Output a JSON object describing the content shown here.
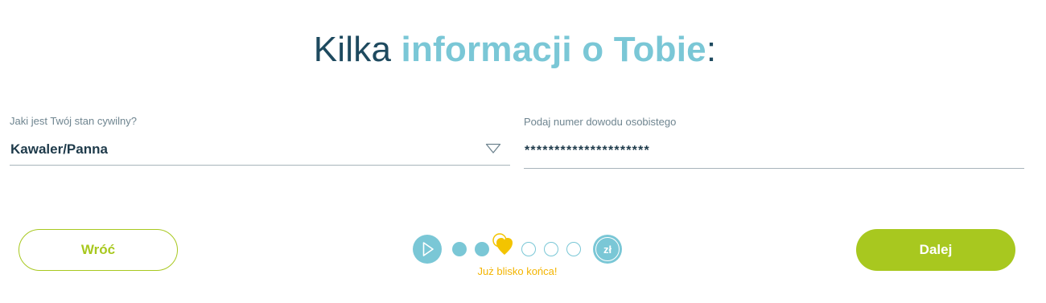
{
  "heading": {
    "prefix": "Kilka ",
    "accent": "informacji o Tobie",
    "suffix": ":"
  },
  "marital_status": {
    "label": "Jaki jest Twój stan cywilny?",
    "value": "Kawaler/Panna",
    "icon": "chevron-down-icon"
  },
  "id_number": {
    "label": "Podaj numer dowodu osobistego",
    "value": "*********************"
  },
  "buttons": {
    "back": "Wróć",
    "next": "Dalej"
  },
  "progress": {
    "caption": "Już blisko końca!",
    "current_step": 3,
    "total_steps": 6,
    "end_label": "zł",
    "start_icon": "play-icon",
    "current_icon": "heart-icon"
  },
  "colors": {
    "primary_dark": "#1e4a5f",
    "accent_teal": "#7ac7d6",
    "accent_green": "#a8c81f",
    "accent_yellow": "#f3b400"
  }
}
